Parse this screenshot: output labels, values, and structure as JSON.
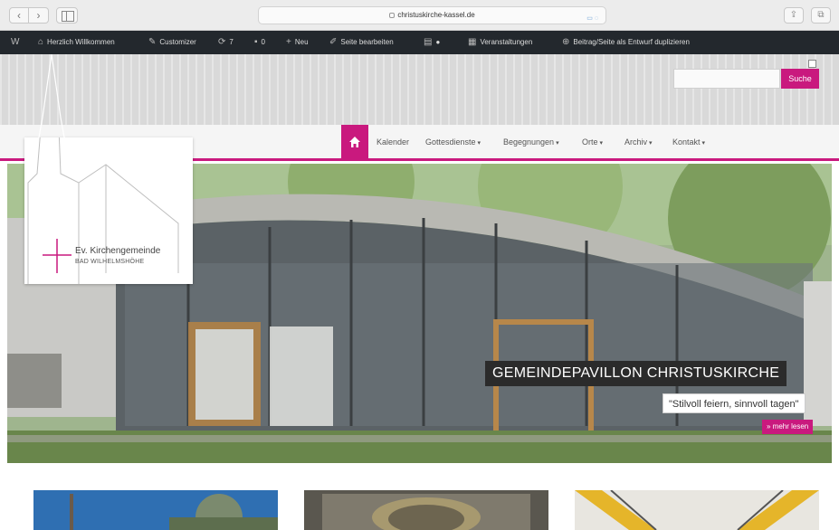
{
  "browser": {
    "url": "christuskirche-kassel.de",
    "reader_label": "▭ ◌",
    "nav_back": "‹",
    "nav_forward": "›",
    "share": "⇪",
    "tabs": "⧉",
    "reload": "↻"
  },
  "admin_bar": {
    "items": [
      {
        "icon": "W",
        "label": ""
      },
      {
        "icon": "⌂",
        "label": "Herzlich Willkommen"
      },
      {
        "icon": "✎",
        "label": "Customizer"
      },
      {
        "icon": "⟳",
        "label": "7"
      },
      {
        "icon": "▪",
        "label": "0"
      },
      {
        "icon": "+",
        "label": "Neu"
      },
      {
        "icon": "✐",
        "label": "Seite bearbeiten"
      },
      {
        "icon": "▤",
        "label": "●"
      },
      {
        "icon": "▦",
        "label": "Veranstaltungen"
      },
      {
        "icon": "⊕",
        "label": "Beitrag/Seite als Entwurf duplizieren"
      }
    ]
  },
  "search": {
    "placeholder": "",
    "button_label": "Suche"
  },
  "nav": {
    "items": [
      {
        "label": "Kalender",
        "has_caret": false
      },
      {
        "label": "Gottesdienste",
        "has_caret": true
      },
      {
        "label": "Begegnungen",
        "has_caret": true
      },
      {
        "label": "Orte",
        "has_caret": true
      },
      {
        "label": "Archiv",
        "has_caret": true
      },
      {
        "label": "Kontakt",
        "has_caret": true
      }
    ],
    "caret": "▾"
  },
  "logo": {
    "name": "Ev. Kirchengemeinde",
    "sub": "BAD WILHELMSHÖHE"
  },
  "hero": {
    "title": "GEMEINDEPAVILLON CHRISTUSKIRCHE",
    "subtitle": "\"Stilvoll feiern, sinnvoll tagen\"",
    "more": "» mehr lesen"
  },
  "colors": {
    "accent": "#c9197e",
    "admin_bg": "#23282d"
  }
}
